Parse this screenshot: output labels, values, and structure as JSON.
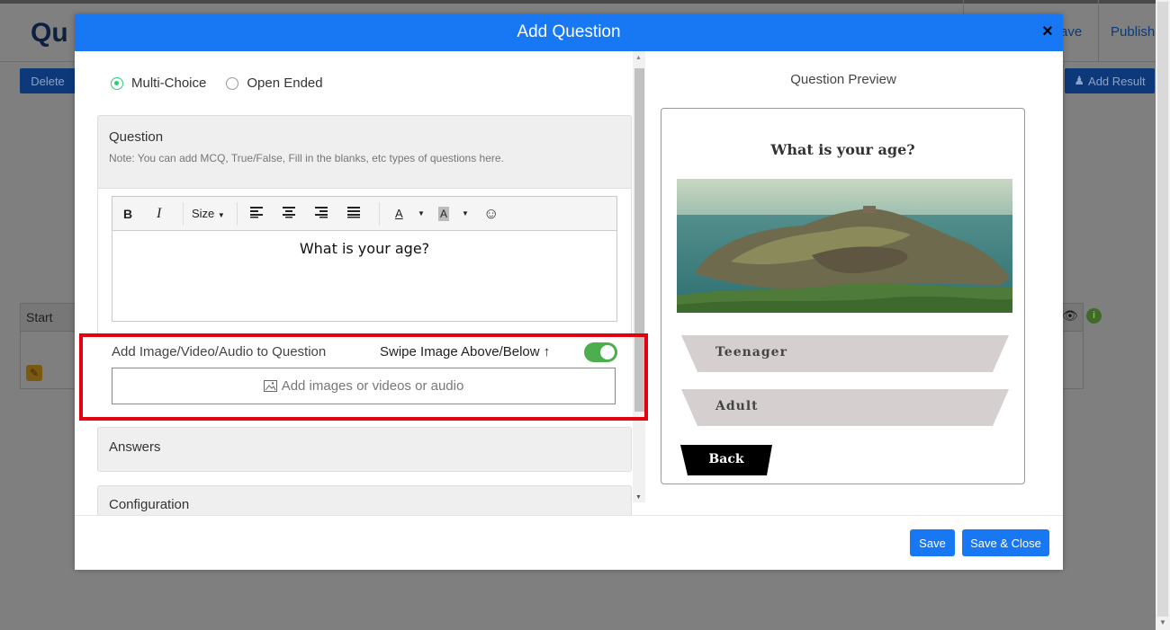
{
  "background": {
    "logo_text": "Qu",
    "save_label": "ave",
    "publish_label": "Publish",
    "delete_label": "Delete",
    "add_result_label": "Add Result",
    "table_start_label": "Start"
  },
  "modal": {
    "title": "Add Question",
    "close_symbol": "×",
    "question_types": [
      {
        "label": "Multi-Choice",
        "selected": true
      },
      {
        "label": "Open Ended",
        "selected": false
      }
    ],
    "question_section": {
      "title": "Question",
      "note": "Note: You can add MCQ, True/False, Fill in the blanks, etc types of questions here."
    },
    "editor": {
      "toolbar": {
        "bold": "B",
        "italic": "I",
        "size": "Size",
        "font_color": "A",
        "bg_color": "A",
        "emoji": "☺"
      },
      "content": "What is your age?"
    },
    "media": {
      "label": "Add Image/Video/Audio to Question",
      "swipe_label": "Swipe Image Above/Below",
      "swipe_enabled": true,
      "upload_placeholder": "Add images or videos or audio"
    },
    "answers_section": {
      "title": "Answers"
    },
    "config_section": {
      "title": "Configuration"
    },
    "preview": {
      "title": "Question Preview",
      "question": "What is your age?",
      "answers": [
        "Teenager",
        "Adult"
      ],
      "back_label": "Back"
    },
    "buttons": {
      "save": "Save",
      "save_close": "Save & Close"
    }
  },
  "colors": {
    "header_blue": "#1877f2",
    "highlight_red": "#e3000f",
    "toggle_green": "#4cae4c",
    "radio_green": "#2ecc71"
  }
}
